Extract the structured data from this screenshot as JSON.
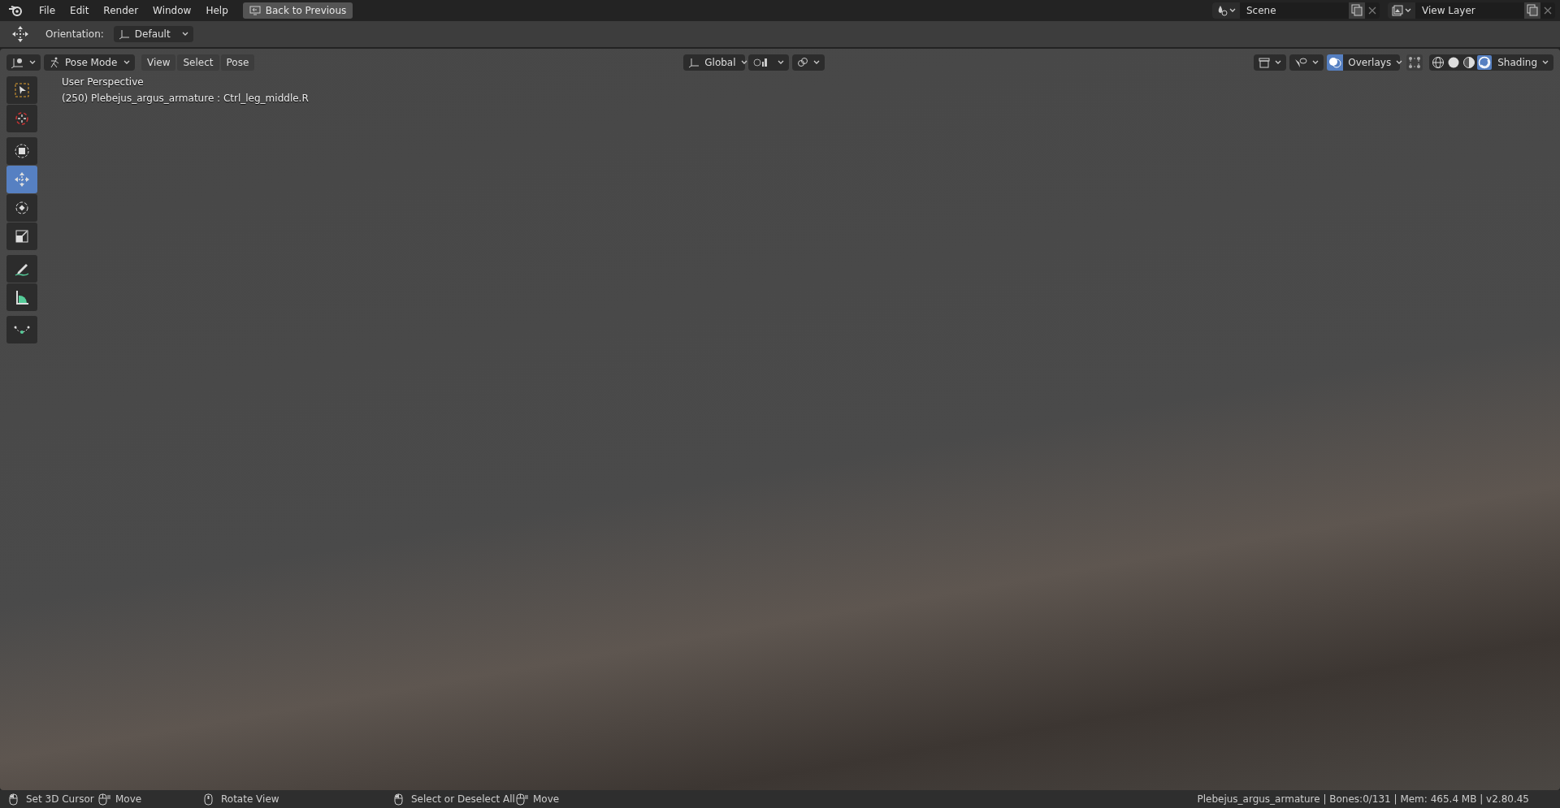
{
  "top_bar": {
    "menu": [
      "File",
      "Edit",
      "Render",
      "Window",
      "Help"
    ],
    "back_button": "Back to Previous",
    "scene": "Scene",
    "view_layer": "View Layer"
  },
  "tool_settings": {
    "orientation_label": "Orientation:",
    "orientation_value": "Default"
  },
  "viewport_header": {
    "mode": "Pose Mode",
    "menus": [
      "View",
      "Select",
      "Pose"
    ],
    "transform_orientation": "Global",
    "overlays": {
      "label": "Overlays",
      "on": true
    },
    "shading": {
      "label": "Shading",
      "modes": [
        {
          "kind": "wireframe",
          "selected": false
        },
        {
          "kind": "solid",
          "selected": false
        },
        {
          "kind": "material",
          "selected": false
        },
        {
          "kind": "rendered",
          "selected": true
        }
      ]
    }
  },
  "toolbar": {
    "groups": [
      [
        {
          "kind": "select-box",
          "selected": false
        },
        {
          "kind": "cursor",
          "selected": false
        }
      ],
      [
        {
          "kind": "transform",
          "selected": false
        },
        {
          "kind": "move",
          "selected": true
        },
        {
          "kind": "rotate",
          "selected": false
        },
        {
          "kind": "scale",
          "selected": false
        }
      ],
      [
        {
          "kind": "annotate",
          "selected": false
        },
        {
          "kind": "measure",
          "selected": false
        }
      ],
      [
        {
          "kind": "curve",
          "selected": false
        }
      ]
    ]
  },
  "viewport": {
    "view_name": "User Perspective",
    "active_object": "(250) Plebejus_argus_armature : Ctrl_leg_middle.R"
  },
  "status_bar": {
    "hints": [
      {
        "kind": "left",
        "label": "Set 3D Cursor"
      },
      {
        "kind": "drag",
        "label": "Move"
      },
      {
        "kind": "middle",
        "label": "Rotate View"
      },
      {
        "kind": "left",
        "label": "Select or Deselect All"
      },
      {
        "kind": "drag",
        "label": "Move"
      }
    ],
    "stats": "Plebejus_argus_armature | Bones:0/131  | Mem: 465.4 MB | v2.80.45"
  }
}
